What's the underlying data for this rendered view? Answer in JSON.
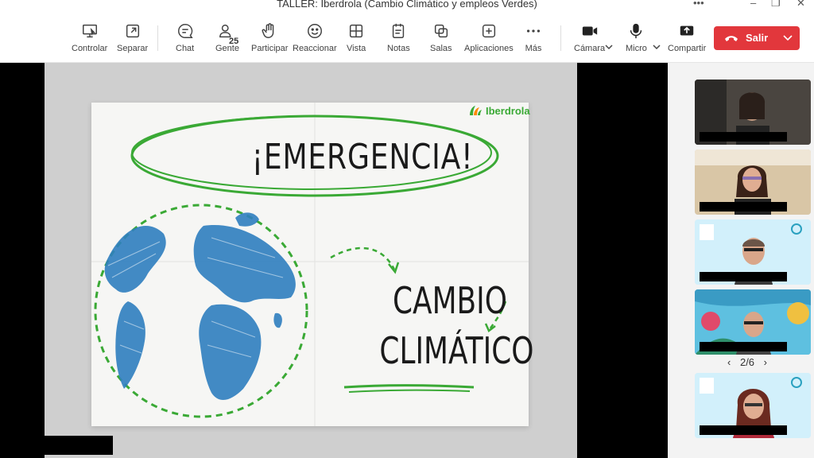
{
  "window": {
    "title": "TALLER: Iberdrola (Cambio Climático y empleos Verdes)"
  },
  "toolbar": {
    "controlar": "Controlar",
    "separar": "Separar",
    "chat": "Chat",
    "gente": "Gente",
    "gente_count": "25",
    "participar": "Participar",
    "reaccionar": "Reaccionar",
    "vista": "Vista",
    "notas": "Notas",
    "salas": "Salas",
    "aplicaciones": "Aplicaciones",
    "mas": "Más",
    "camara": "Cámara",
    "micro": "Micro",
    "compartir": "Compartir",
    "salir": "Salir"
  },
  "slide": {
    "logo": "Iberdrola",
    "headline": "¡EMERGENCIA!",
    "line1": "CAMBIO",
    "line2": "CLIMÁTICO"
  },
  "participants": {
    "pager": "2/6"
  },
  "colors": {
    "leave_red": "#e2373c",
    "iberdrola_green": "#3aa935",
    "globe_blue": "#2f7fbf"
  }
}
